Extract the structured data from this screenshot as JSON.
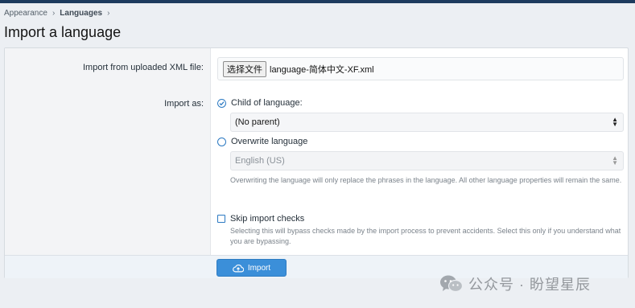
{
  "breadcrumb": {
    "items": [
      "Appearance",
      "Languages"
    ],
    "separator": "›"
  },
  "page_title": "Import a language",
  "form": {
    "upload_label": "Import from uploaded XML file:",
    "file_button_label": "选择文件",
    "file_name": "language-简体中文-XF.xml",
    "import_as_label": "Import as:",
    "child_option_label": "Child of language:",
    "child_option_checked": true,
    "parent_select_value": "(No parent)",
    "overwrite_option_label": "Overwrite language",
    "overwrite_option_checked": false,
    "overwrite_select_value": "English (US)",
    "overwrite_hint": "Overwriting the language will only replace the phrases in the language. All other language properties will remain the same.",
    "skip_checks_label": "Skip import checks",
    "skip_checks_checked": false,
    "skip_checks_hint": "Selecting this will bypass checks made by the import process to prevent accidents. Select this only if you understand what you are bypassing.",
    "submit_label": "Import"
  },
  "watermark": {
    "text": "公众号 · 盼望星辰",
    "icon": "wechat-icon"
  },
  "colors": {
    "accent": "#2b79c2",
    "button": "#3b8fd9",
    "topbar": "#1d3b5e"
  }
}
